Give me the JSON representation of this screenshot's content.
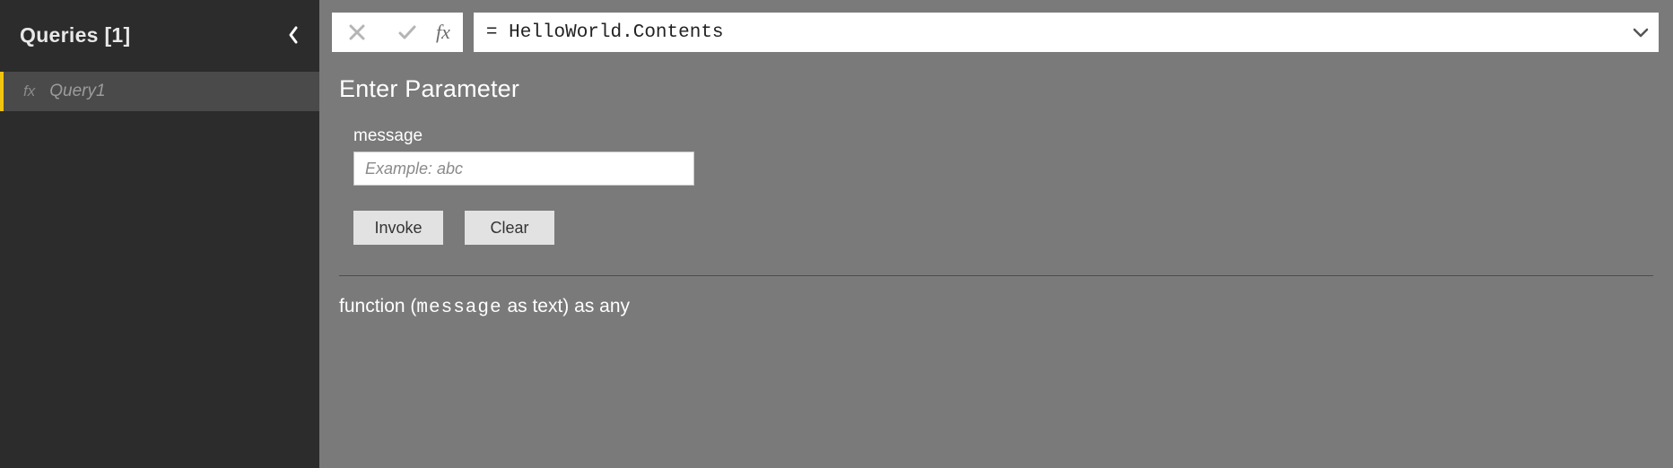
{
  "sidebar": {
    "title": "Queries [1]",
    "items": [
      {
        "label": "Query1"
      }
    ]
  },
  "formulaBar": {
    "fxLabel": "fx",
    "expression": "= HelloWorld.Contents"
  },
  "panel": {
    "title": "Enter Parameter",
    "param": {
      "label": "message",
      "placeholder": "Example: abc",
      "value": ""
    },
    "buttons": {
      "invoke": "Invoke",
      "clear": "Clear"
    }
  },
  "signature": {
    "prefix": "function (",
    "paramName": "message",
    "mid": " as text) as any"
  }
}
